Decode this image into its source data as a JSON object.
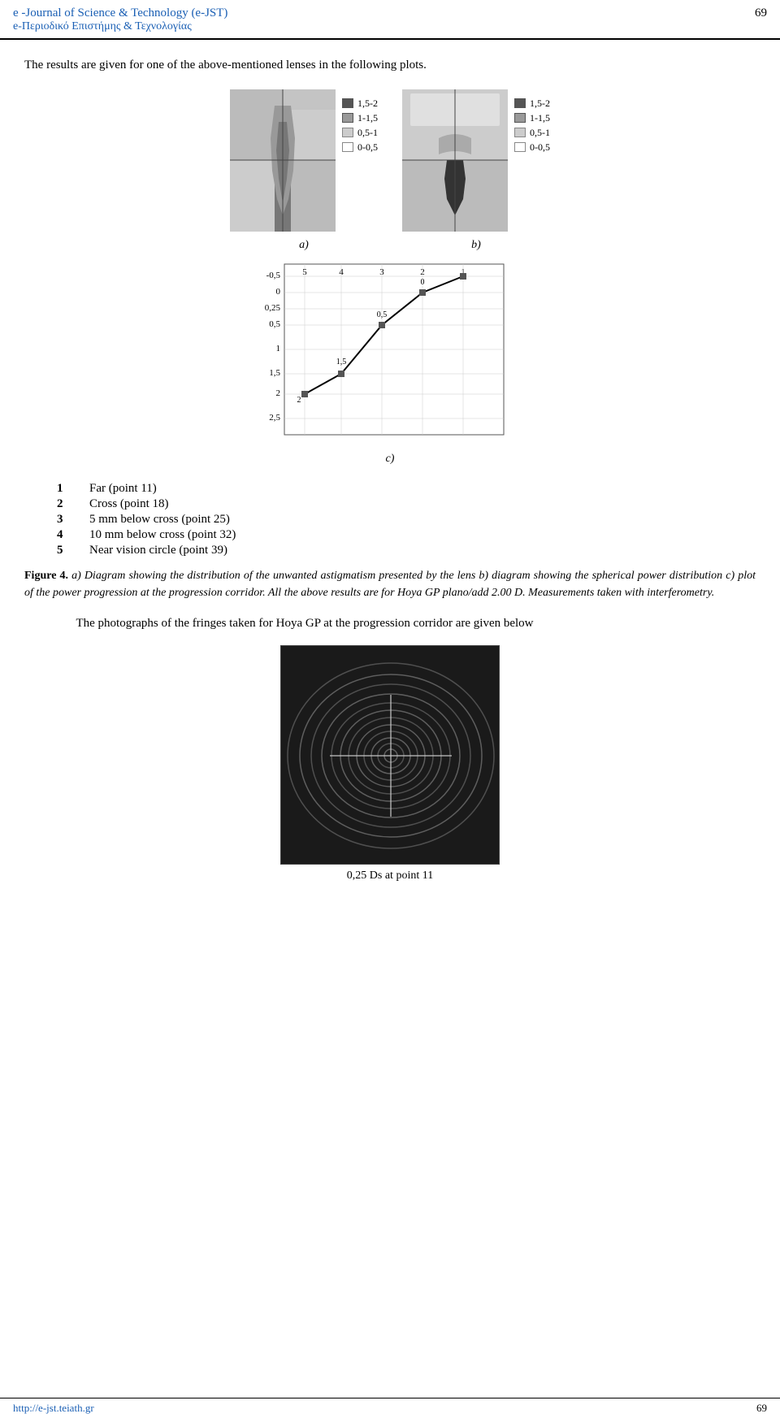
{
  "header": {
    "title_en": "e -Journal of Science & Technology (e-JST)",
    "title_gr": "e-Περιοδικό Επιστήμης & Τεχνολογίας",
    "page_number": "69"
  },
  "intro": {
    "text": "The results are given for one of the above-mentioned lenses in the following plots."
  },
  "legend": {
    "item1": "1,5-2",
    "item2": "1-1,5",
    "item3": "0,5-1",
    "item4": "0-0,5"
  },
  "fig_labels": {
    "a": "a)",
    "b": "b)",
    "c": "c)"
  },
  "point_list": {
    "items": [
      {
        "num": "1",
        "label": "Far (point 11)"
      },
      {
        "num": "2",
        "label": "Cross (point 18)"
      },
      {
        "num": "3",
        "label": "5 mm below cross (point 25)"
      },
      {
        "num": "4",
        "label": "10 mm below cross (point 32)"
      },
      {
        "num": "5",
        "label": "Near vision circle (point 39)"
      }
    ]
  },
  "figure_caption": {
    "label": "Figure 4.",
    "text": "a) Diagram showing the distribution of the unwanted astigmatism presented by the lens b) diagram showing the spherical power distribution c) plot of the power progression at the progression corridor. All the above results are for Hoya GP plano/add 2.00 D. Measurements taken with interferometry."
  },
  "photo_para": {
    "text": "The photographs of the fringes taken for Hoya GP at the progression corridor are given below"
  },
  "photo_caption": {
    "text": "0,25 Ds    at point 11"
  },
  "footer": {
    "url": "http://e-jst.teiath.gr",
    "page": "69"
  }
}
